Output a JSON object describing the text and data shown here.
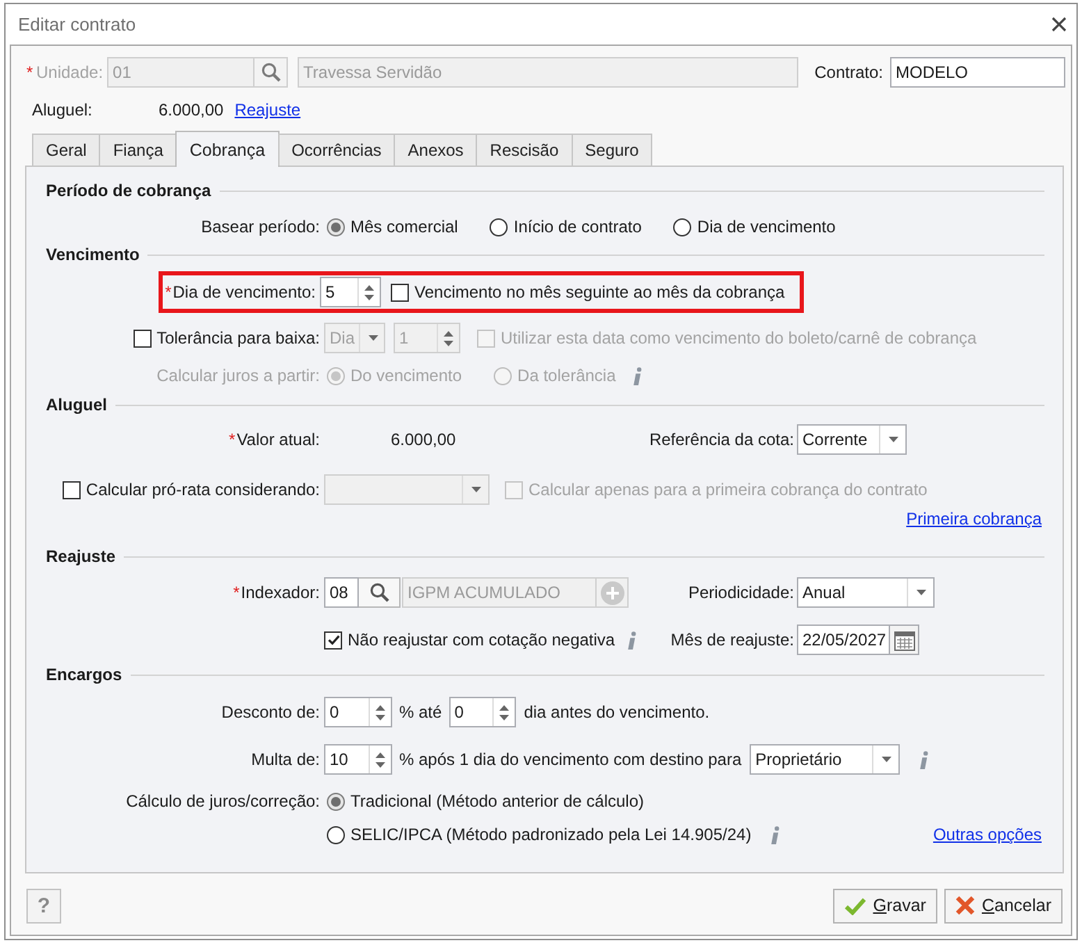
{
  "window": {
    "title": "Editar contrato"
  },
  "header": {
    "unit": {
      "required_mark": "*",
      "label": "Unidade:",
      "code": "01",
      "name": "Travessa Servidão",
      "disabled": true
    },
    "contract": {
      "label": "Contrato:",
      "value": "MODELO"
    },
    "rent": {
      "label": "Aluguel:",
      "value": "6.000,00",
      "link": "Reajuste"
    }
  },
  "tabs": [
    {
      "label": "Geral",
      "selected": false
    },
    {
      "label": "Fiança",
      "selected": false
    },
    {
      "label": "Cobrança",
      "selected": true
    },
    {
      "label": "Ocorrências",
      "selected": false
    },
    {
      "label": "Anexos",
      "selected": false
    },
    {
      "label": "Rescisão",
      "selected": false
    },
    {
      "label": "Seguro",
      "selected": false
    }
  ],
  "billing_period": {
    "title": "Período de cobrança",
    "label": "Basear período:",
    "options": [
      {
        "label": "Mês comercial",
        "selected": true
      },
      {
        "label": "Início de contrato",
        "selected": false
      },
      {
        "label": "Dia de vencimento",
        "selected": false
      }
    ]
  },
  "due": {
    "title": "Vencimento",
    "highlighted": true,
    "due_day": {
      "required_mark": "*",
      "label": "Dia de vencimento:",
      "value": "5"
    },
    "next_month": {
      "label": "Vencimento no mês seguinte ao mês da cobrança",
      "checked": false
    },
    "tolerance": {
      "label": "Tolerância para baixa:",
      "checked": false,
      "unit": "Dia",
      "value": "1",
      "disabled": true
    },
    "use_as_due_date": {
      "label": "Utilizar esta data como vencimento do boleto/carnê de cobrança",
      "checked": false,
      "disabled": true
    },
    "interest_from": {
      "label": "Calcular juros a partir:",
      "disabled": true,
      "options": [
        {
          "label": "Do vencimento",
          "selected": true
        },
        {
          "label": "Da tolerância",
          "selected": false
        }
      ]
    }
  },
  "rent": {
    "title": "Aluguel",
    "current_value": {
      "required_mark": "*",
      "label": "Valor atual:",
      "value": "6.000,00"
    },
    "quota_reference": {
      "label": "Referência da cota:",
      "value": "Corrente"
    },
    "pro_rata": {
      "label": "Calcular pró-rata considerando:",
      "checked": false,
      "select_disabled": true
    },
    "first_only": {
      "label": "Calcular apenas para a primeira cobrança do contrato",
      "checked": false,
      "disabled": true
    },
    "link": "Primeira cobrança"
  },
  "adjustment": {
    "title": "Reajuste",
    "indexer": {
      "required_mark": "*",
      "label": "Indexador:",
      "code": "08",
      "name": "IGPM ACUMULADO",
      "name_disabled": true
    },
    "periodicity": {
      "label": "Periodicidade:",
      "value": "Anual"
    },
    "skip_negative": {
      "label": "Não reajustar com cotação negativa",
      "checked": true
    },
    "adjustment_month": {
      "label": "Mês de reajuste:",
      "value": "22/05/2027"
    }
  },
  "charges": {
    "title": "Encargos",
    "discount": {
      "label": "Desconto de:",
      "value": "0",
      "middle": "% até",
      "days": "0",
      "suffix": "dia antes do vencimento."
    },
    "fine": {
      "label": "Multa de:",
      "value": "10",
      "suffix": "% após 1 dia do vencimento com destino para",
      "destination": "Proprietário"
    },
    "interest": {
      "label": "Cálculo de juros/correção:",
      "options": [
        {
          "label": "Tradicional (Método anterior de cálculo)",
          "selected": true
        },
        {
          "label": "SELIC/IPCA (Método padronizado pela Lei 14.905/24)",
          "selected": false
        }
      ]
    },
    "link": "Outras opções"
  },
  "footer": {
    "help": "?",
    "buttons": [
      {
        "label": "Gravar",
        "kind": "save"
      },
      {
        "label": "Cancelar",
        "kind": "cancel"
      }
    ]
  }
}
